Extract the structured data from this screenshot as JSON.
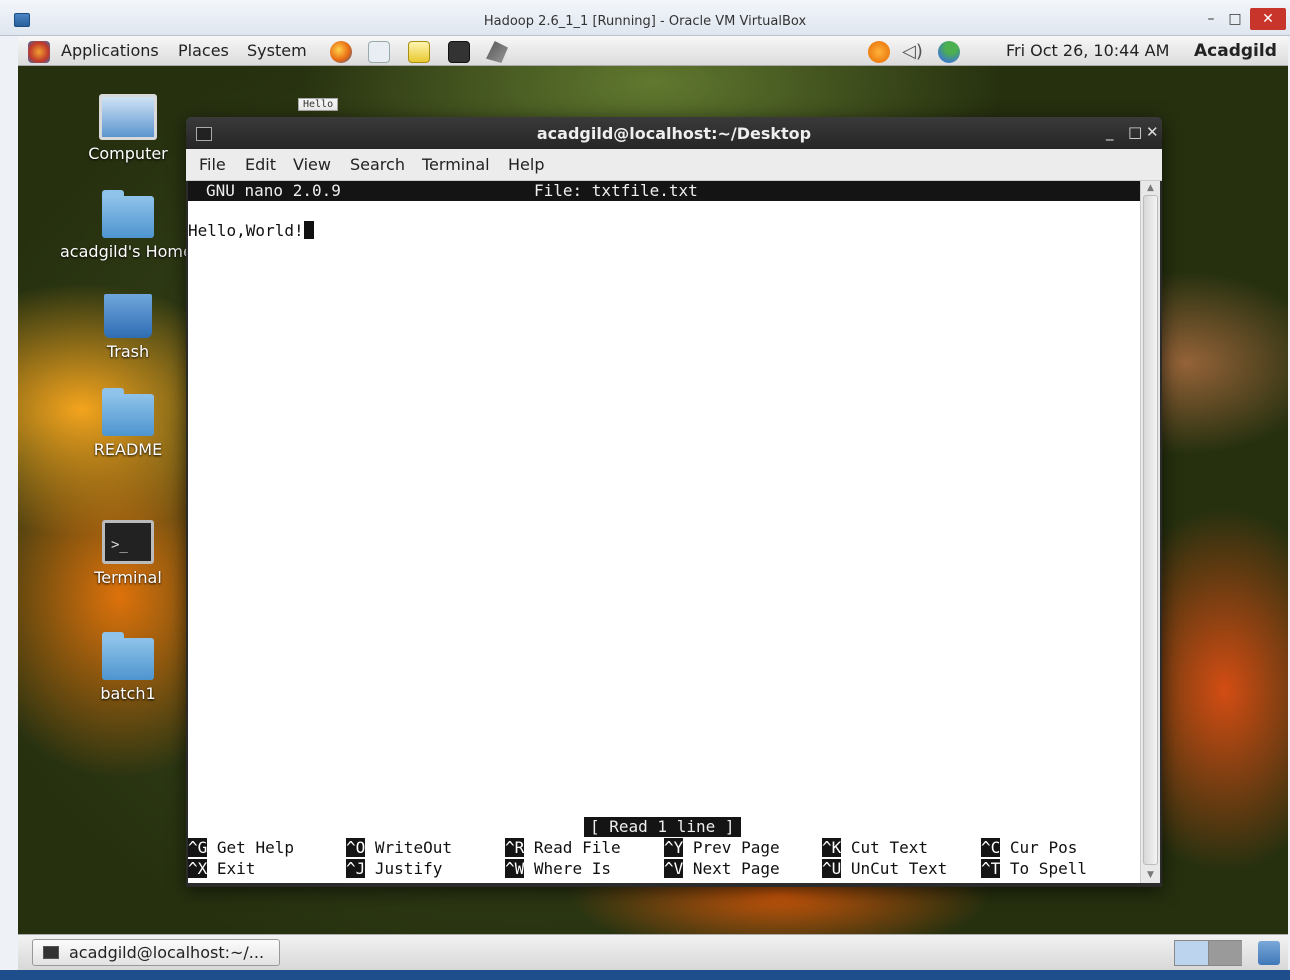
{
  "host_window": {
    "title": "Hadoop 2.6_1_1 [Running] - Oracle VM VirtualBox",
    "minimize": "–",
    "maximize": "□",
    "close": "✕"
  },
  "top_panel": {
    "menus": [
      "Applications",
      "Places",
      "System"
    ],
    "clock": "Fri Oct 26, 10:44 AM",
    "user": "Acadgild"
  },
  "desktop": {
    "mini_note": "Hello",
    "icons": [
      {
        "label": "Computer",
        "icon": "computer-icon"
      },
      {
        "label": "acadgild's Home",
        "icon": "home-folder-icon"
      },
      {
        "label": "Trash",
        "icon": "trash-icon"
      },
      {
        "label": "README",
        "icon": "folder-icon"
      },
      {
        "label": "Terminal",
        "icon": "terminal-icon"
      },
      {
        "label": "batch1",
        "icon": "folder-icon"
      }
    ]
  },
  "terminal": {
    "title": "acadgild@localhost:~/Desktop",
    "controls": [
      "_",
      "□",
      "✕"
    ],
    "menu": [
      "File",
      "Edit",
      "View",
      "Search",
      "Terminal",
      "Help"
    ],
    "nano": {
      "version": "GNU nano 2.0.9",
      "file": "File: txtfile.txt",
      "content": "Hello,World!",
      "status": "[ Read 1 line ]",
      "shortcuts_row1": [
        {
          "key": "^G",
          "label": "Get Help"
        },
        {
          "key": "^O",
          "label": "WriteOut"
        },
        {
          "key": "^R",
          "label": "Read File"
        },
        {
          "key": "^Y",
          "label": "Prev Page"
        },
        {
          "key": "^K",
          "label": "Cut Text"
        },
        {
          "key": "^C",
          "label": "Cur Pos"
        }
      ],
      "shortcuts_row2": [
        {
          "key": "^X",
          "label": "Exit"
        },
        {
          "key": "^J",
          "label": "Justify"
        },
        {
          "key": "^W",
          "label": "Where Is"
        },
        {
          "key": "^V",
          "label": "Next Page"
        },
        {
          "key": "^U",
          "label": "UnCut Text"
        },
        {
          "key": "^T",
          "label": "To Spell"
        }
      ]
    }
  },
  "bottom_panel": {
    "task_label": "acadgild@localhost:~/..."
  }
}
